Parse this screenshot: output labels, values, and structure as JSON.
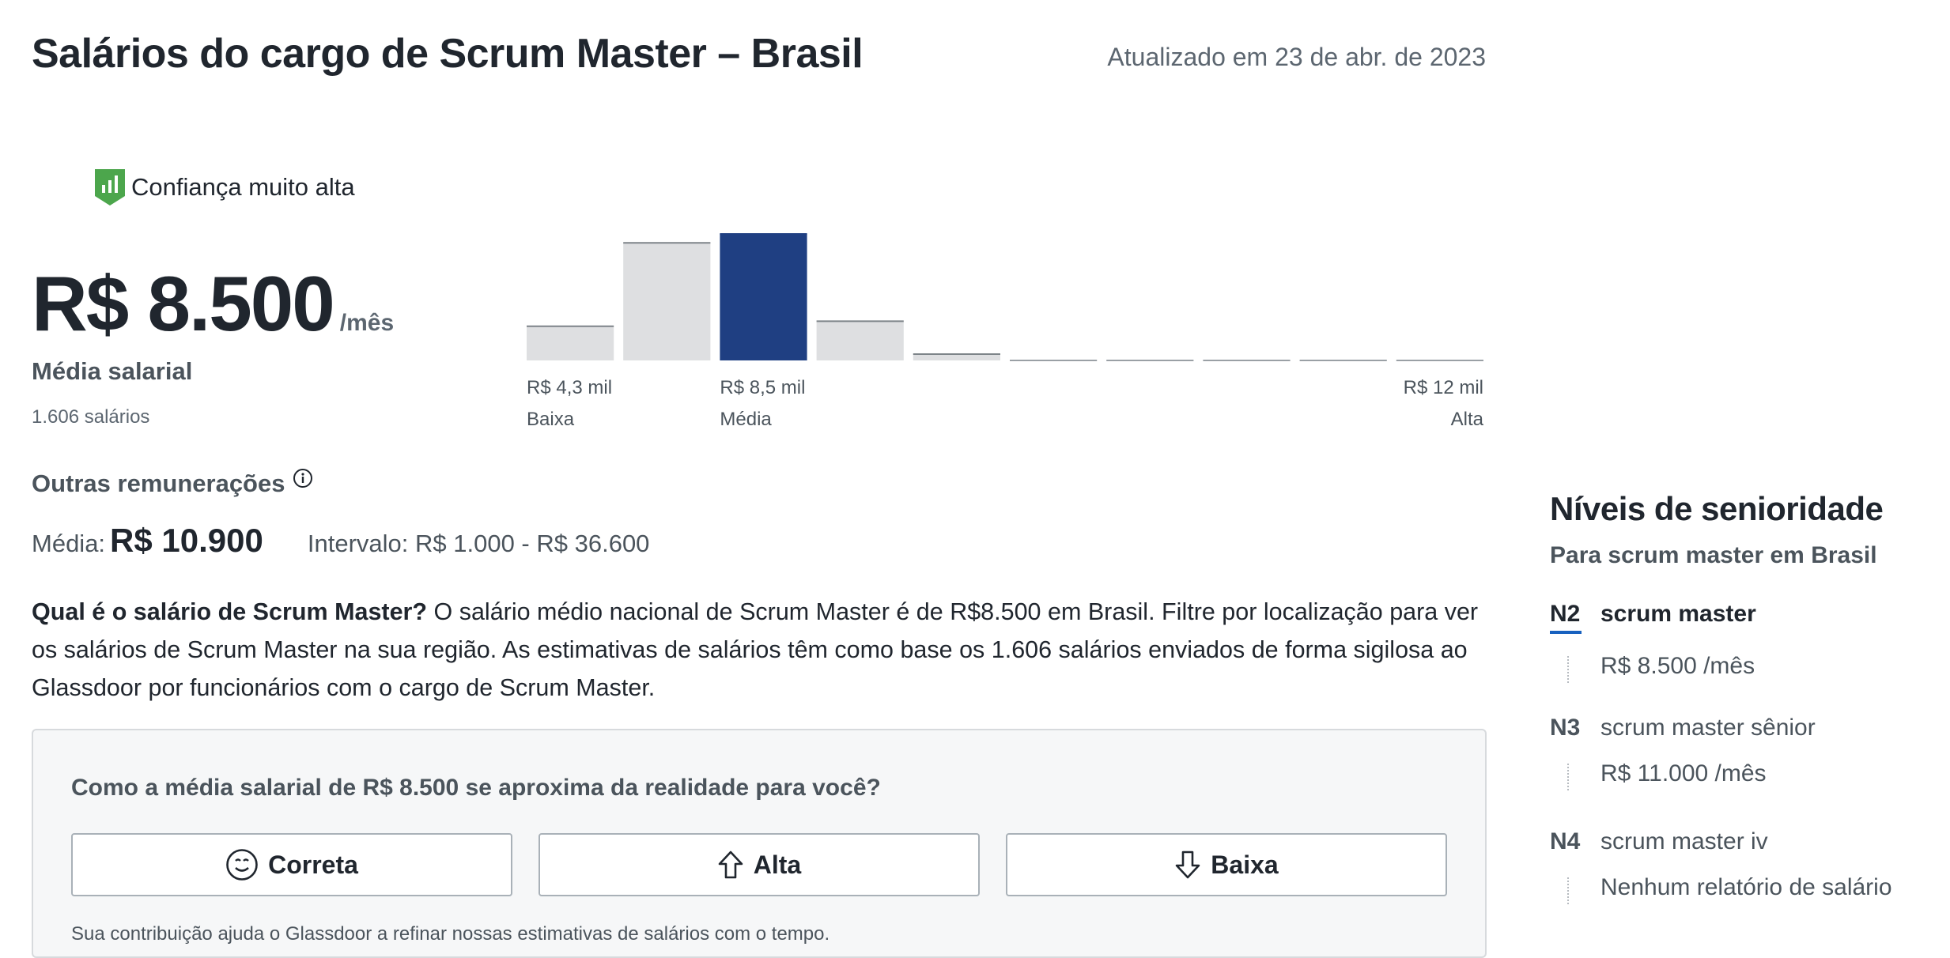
{
  "header": {
    "title": "Salários do cargo de Scrum Master – Brasil",
    "updated": "Atualizado em 23 de abr. de 2023"
  },
  "confidence": {
    "icon": "confidence-shield-icon",
    "label": "Confiança muito alta",
    "color": "#4ca64c"
  },
  "salary": {
    "value": "R$ 8.500",
    "unit": "/mês",
    "label": "Média salarial",
    "count": "1.606 salários"
  },
  "chart_data": {
    "type": "bar",
    "title": "",
    "values_fraction_of_max": [
      0.27,
      0.93,
      1.0,
      0.31,
      0.05,
      0.0,
      0.0,
      0.0,
      0.0,
      0.0
    ],
    "highlight_index": 2,
    "colors": {
      "bar": "#dedfe1",
      "bar_edge": "#7d8489",
      "highlight": "#1f3f82",
      "baseline": "#9aa0a5"
    },
    "tick_labels": [
      {
        "value": "R$ 4,3 mil",
        "caption": "Baixa",
        "position": "left"
      },
      {
        "value": "R$ 8,5 mil",
        "caption": "Média",
        "position": "center"
      },
      {
        "value": "R$ 12 mil",
        "caption": "Alta",
        "position": "right"
      }
    ]
  },
  "other_comp": {
    "title": "Outras remunerações",
    "media_label": "Média:",
    "media_value": "R$ 10.900",
    "range": "Intervalo: R$ 1.000 - R$ 36.600"
  },
  "description": {
    "question": "Qual é o salário de Scrum Master?",
    "text": " O salário médio nacional de Scrum Master é de R$8.500 em Brasil. Filtre por localização para ver os salários de Scrum Master na sua região. As estimativas de salários têm como base os 1.606 salários enviados de forma sigilosa ao Glassdoor por funcionários com o cargo de Scrum Master."
  },
  "feedback": {
    "question": "Como a média salarial de R$ 8.500 se aproxima da realidade para você?",
    "buttons": [
      {
        "label": "Correta",
        "icon": "smile-icon"
      },
      {
        "label": "Alta",
        "icon": "arrow-up-icon"
      },
      {
        "label": "Baixa",
        "icon": "arrow-down-icon"
      }
    ],
    "note": "Sua contribuição ajuda o Glassdoor a refinar nossas estimativas de salários com o tempo."
  },
  "seniority": {
    "title": "Níveis de senioridade",
    "subtitle": "Para scrum master em Brasil",
    "levels": [
      {
        "code": "N2",
        "name": "scrum master",
        "salary": "R$ 8.500 /mês"
      },
      {
        "code": "N3",
        "name": "scrum master sênior",
        "salary": "R$ 11.000 /mês"
      },
      {
        "code": "N4",
        "name": "scrum master iv",
        "salary": "Nenhum relatório de salário"
      }
    ]
  }
}
